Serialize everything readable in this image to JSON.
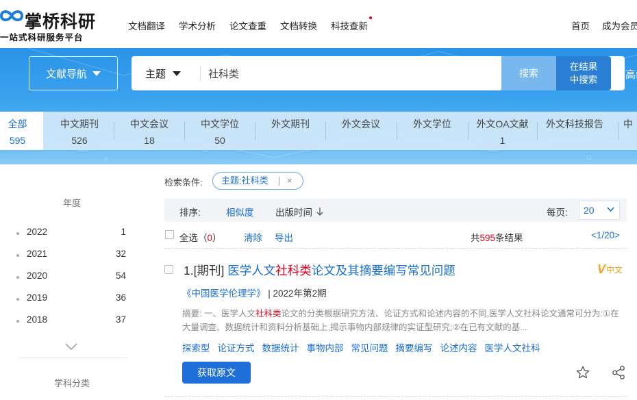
{
  "brand": {
    "title": "掌桥科研",
    "subtitle": "一站式科研服务平台",
    "logo_icon": "infinity-logo-icon",
    "accent": "#1e6fd9",
    "highlight": "#e0001b"
  },
  "nav": {
    "items": [
      {
        "label": "文档翻译"
      },
      {
        "label": "学术分析"
      },
      {
        "label": "论文查重"
      },
      {
        "label": "文档转换"
      },
      {
        "label": "科技查新",
        "has_dot": true
      }
    ],
    "right": [
      {
        "label": "首页"
      },
      {
        "label": "成为会员"
      }
    ]
  },
  "search": {
    "nav_button": "文献导航",
    "type": "主题",
    "value": "社科类",
    "search_button": "搜索",
    "within_button_line1": "在结果",
    "within_button_line2": "中搜索",
    "advanced": "高级"
  },
  "tabs": [
    {
      "label": "全部",
      "count": "595",
      "active": true
    },
    {
      "label": "中文期刊",
      "count": "526"
    },
    {
      "label": "中文会议",
      "count": "18"
    },
    {
      "label": "中文学位",
      "count": "50"
    },
    {
      "label": "外文期刊",
      "count": ""
    },
    {
      "label": "外文会议",
      "count": ""
    },
    {
      "label": "外文学位",
      "count": ""
    },
    {
      "label": "外文OA文献",
      "count": "1"
    },
    {
      "label": "外文科技报告",
      "count": ""
    },
    {
      "label": "中",
      "count": ""
    }
  ],
  "sidebar": {
    "year_heading": "年度",
    "years": [
      {
        "year": "2022",
        "count": "1"
      },
      {
        "year": "2021",
        "count": "32"
      },
      {
        "year": "2020",
        "count": "54"
      },
      {
        "year": "2019",
        "count": "36"
      },
      {
        "year": "2018",
        "count": "37"
      }
    ],
    "subject_heading": "学科分类"
  },
  "conditions": {
    "label": "检索条件:",
    "tag": "主题:社科类",
    "close": "×"
  },
  "sort": {
    "label": "排序:",
    "relevance": "相似度",
    "pub_time": "出版时间",
    "per_page_label": "每页:",
    "per_page_value": "20"
  },
  "actions": {
    "select_all": "全选",
    "selected_count": "0",
    "clear": "清除",
    "export": "导出",
    "total_prefix": "共",
    "total": "595",
    "total_suffix": "条结果",
    "pager": "<1/20>"
  },
  "result": {
    "num": "1.[期刊]",
    "title_before": "医学人文",
    "title_hl": "社科类",
    "title_after": "论文及其摘要编写常见问题",
    "lang": "中文",
    "lang_mark": "V",
    "journal": "《中国医学伦理学》",
    "issue": "2022年第2期",
    "abstract_before": "摘要: 一、医学人文",
    "abstract_hl": "社科类",
    "abstract_after": "论文的分类根据研究方法、论证方式和论述内容的不同,医学人文社科论文通常可分为:①在大量调查、数据统计和资料分析基础上,揭示事物内部规律的实证型研究;②在已有文献的基...",
    "keywords": [
      "探索型",
      "论证方式",
      "数据统计",
      "事物内部",
      "常见问题",
      "摘要编写",
      "论述内容",
      "医学人文社科"
    ],
    "get_button": "获取原文"
  }
}
